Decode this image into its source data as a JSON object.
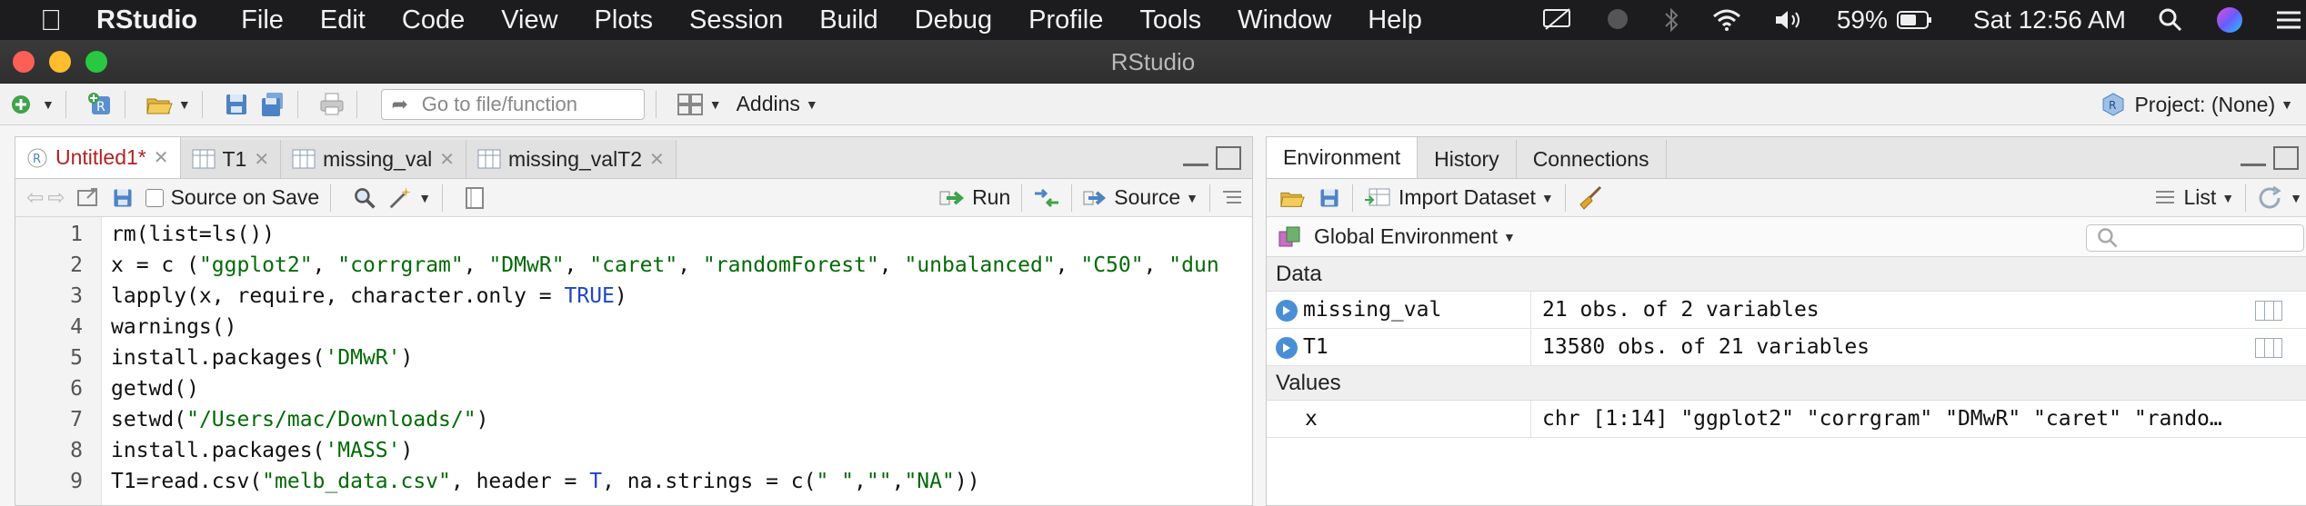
{
  "menubar": {
    "app": "RStudio",
    "items": [
      "File",
      "Edit",
      "Code",
      "View",
      "Plots",
      "Session",
      "Build",
      "Debug",
      "Profile",
      "Tools",
      "Window",
      "Help"
    ],
    "battery": "59%",
    "datetime": "Sat 12:56 AM"
  },
  "window": {
    "title": "RStudio"
  },
  "toolbar": {
    "goto_placeholder": "Go to file/function",
    "addins": "Addins",
    "project": "Project: (None)"
  },
  "source": {
    "tabs": [
      {
        "label": "Untitled1*",
        "active": true
      },
      {
        "label": "T1",
        "active": false
      },
      {
        "label": "missing_val",
        "active": false
      },
      {
        "label": "missing_valT2",
        "active": false
      }
    ],
    "toolbar": {
      "source_on_save": "Source on Save",
      "run": "Run",
      "source": "Source"
    },
    "lines": [
      {
        "n": "1",
        "html": "rm(list=ls())"
      },
      {
        "n": "2",
        "html": "x = c (<span class='str'>\"ggplot2\"</span>, <span class='str'>\"corrgram\"</span>, <span class='str'>\"DMwR\"</span>, <span class='str'>\"caret\"</span>, <span class='str'>\"randomForest\"</span>, <span class='str'>\"unbalanced\"</span>, <span class='str'>\"C50\"</span>, <span class='str'>\"dun</span>"
      },
      {
        "n": "3",
        "html": "lapply(x, require, character.only =  <span class='kw'>TRUE</span>)"
      },
      {
        "n": "4",
        "html": "warnings()"
      },
      {
        "n": "5",
        "html": "install.packages(<span class='str'>'DMwR'</span>)"
      },
      {
        "n": "6",
        "html": "getwd()"
      },
      {
        "n": "7",
        "html": "setwd(<span class='str'>\"/Users/mac/Downloads/\"</span>)"
      },
      {
        "n": "8",
        "html": "install.packages(<span class='str'>'MASS'</span>)"
      },
      {
        "n": "9",
        "html": "T1=read.csv(<span class='str'>\"melb_data.csv\"</span>,  header = <span class='kw'>T</span>, na.strings =  c(<span class='str'>\" \"</span>,<span class='str'>\"\"</span>,<span class='str'>\"NA\"</span>))"
      }
    ]
  },
  "environment": {
    "tabs": [
      "Environment",
      "History",
      "Connections"
    ],
    "import_dataset": "Import Dataset",
    "list_view": "List",
    "scope": "Global Environment",
    "data_header": "Data",
    "data": [
      {
        "name": "missing_val",
        "value": "21 obs. of 2 variables"
      },
      {
        "name": "T1",
        "value": "13580 obs. of 21 variables"
      }
    ],
    "values_header": "Values",
    "values": [
      {
        "name": "x",
        "value": "chr [1:14] \"ggplot2\" \"corrgram\" \"DMwR\" \"caret\" \"rando…"
      }
    ]
  }
}
